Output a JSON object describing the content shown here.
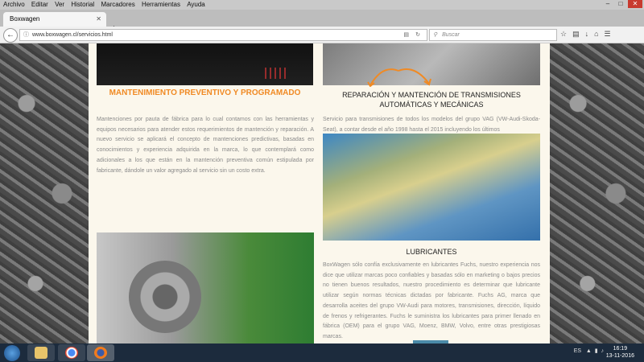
{
  "menubar": {
    "items": [
      "Archivo",
      "Editar",
      "Ver",
      "Historial",
      "Marcadores",
      "Herramientas",
      "Ayuda"
    ]
  },
  "tab": {
    "title": "Boxwagen"
  },
  "nav": {
    "url": "www.boxwagen.cl/servicios.html",
    "search_placeholder": "Buscar"
  },
  "page": {
    "heading_mantenimiento": "MANTENIMIENTO PREVENTIVO Y PROGRAMADO",
    "text_mantenimiento": "Mantenciones por pauta de fábrica para lo cual contamos con las herramientas y equipos necesarios para atender estos requerimientos de mantención y reparación. A nuevo servicio se aplicará el concepto de mantenciones predictivas, basadas en conocimientos y experiencia adquirida en la marca, lo que contemplará como adicionales a los que están en la mantención preventiva común estipulada por fabricante, dándole un valor agregado al servicio sin un costo extra.",
    "heading_transmisiones": "REPARACIÓN Y MANTENCIÓN DE TRANSMISIONES AUTOMÁTICAS Y MECÁNICAS",
    "text_transmisiones": "Servicio para transmisiones de todos los modelos del grupo VAG (VW-Audi-Skoda-Seat), a contar desde el año 1998 hasta el 2015 incluyendo los últimos",
    "heading_lubricantes": "LUBRICANTES",
    "text_lubricantes": "BoxWagen sólo confía exclusivamente en lubricantes Fuchs, nuestro experiencia nos dice que utilizar marcas poco confiables y basadas sólo en marketing o bajos precios no tienen buenos resultados, nuestro procedimiento es determinar que lubricante utilizar según normas técnicas dictadas por fabricante. Fuchs AG, marca que desarrolla aceites del grupo VW-Audi para motores, transmisiones, dirección, líquido de frenos y refrigerantes. Fuchs le suministra los lubricantes para primer llenado en fábrica (OEM) para el grupo VAG, Moenz, BMW, Volvo, entre otras prestigiosas marcas."
  },
  "taskbar": {
    "language": "ES",
    "time": "16:19",
    "date": "13-11-2016"
  },
  "colors": {
    "accent_orange": "#f08a24",
    "taskbar": "#1c2b3d"
  }
}
